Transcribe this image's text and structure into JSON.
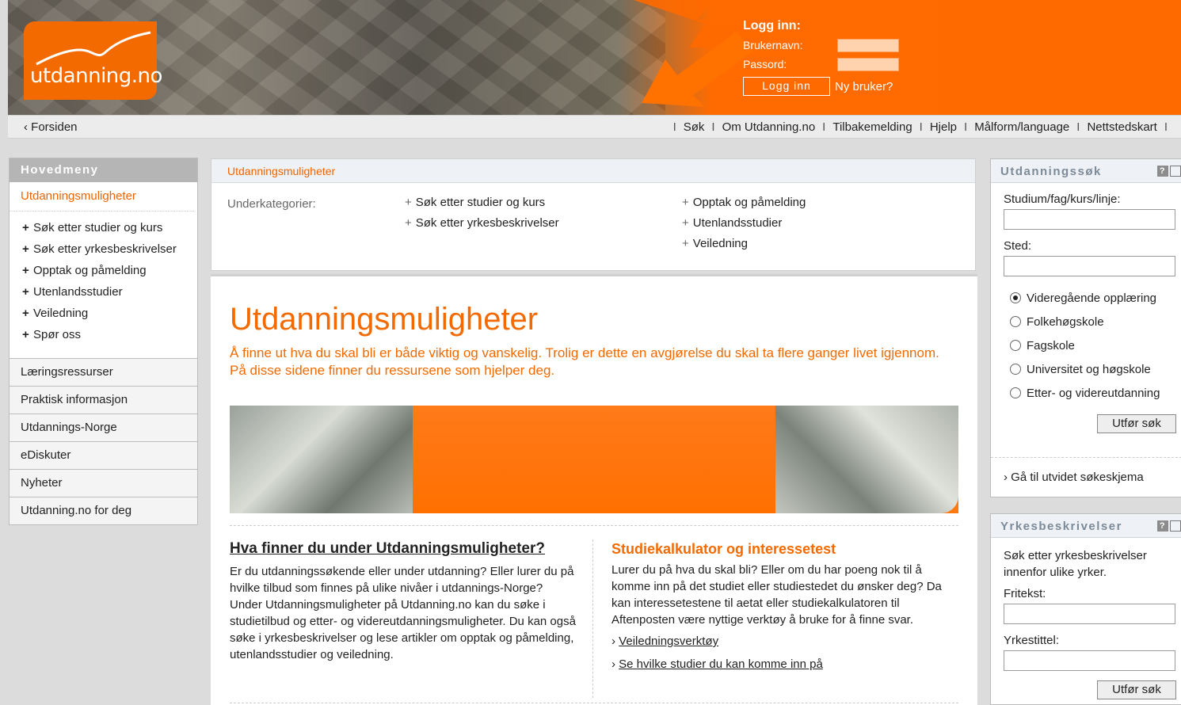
{
  "header": {
    "logo_text": "utdanning.no",
    "login": {
      "title": "Logg inn:",
      "username_label": "Brukernavn:",
      "password_label": "Passord:",
      "button": "Logg inn",
      "new_user": "Ny bruker?"
    }
  },
  "topnav": {
    "home": "‹ Forsiden",
    "links": [
      "Søk",
      "Om Utdanning.no",
      "Tilbakemelding",
      "Hjelp",
      "Målform/language",
      "Nettstedskart"
    ]
  },
  "leftmenu": {
    "title": "Hovedmeny",
    "active": "Utdanningsmuligheter",
    "subitems": [
      "Søk etter studier og kurs",
      "Søk etter yrkesbeskrivelser",
      "Opptak og påmelding",
      "Utenlandsstudier",
      "Veiledning",
      "Spør oss"
    ],
    "items": [
      "Læringsressurser",
      "Praktisk informasjon",
      "Utdannings-Norge",
      "eDiskuter",
      "Nyheter",
      "Utdanning.no for deg"
    ]
  },
  "subcats": {
    "breadcrumb": "Utdanningsmuligheter",
    "label": "Underkategorier:",
    "col1": [
      "Søk etter studier og kurs",
      "Søk etter yrkesbeskrivelser"
    ],
    "col2": [
      "Opptak og påmelding",
      "Utenlandsstudier",
      "Veiledning"
    ]
  },
  "main": {
    "title": "Utdanningsmuligheter",
    "intro": "Å finne ut hva du skal bli er både viktig og vanskelig. Trolig er dette en avgjørelse du skal ta flere ganger livet igjennom. På disse sidene finner du ressursene som hjelper deg.",
    "left": {
      "heading": "Hva finner du under Utdanningsmuligheter?",
      "text": "Er du utdanningssøkende eller under utdanning? Eller lurer du på hvilke tilbud som finnes på ulike nivåer i utdannings-Norge? Under Utdanningsmuligheter på Utdanning.no kan du søke i studietilbud og etter- og videreutdanningsmuligheter. Du kan også søke i yrkesbeskrivelser og lese artikler om opptak og påmelding, utenlandsstudier og veiledning."
    },
    "right": {
      "heading": "Studiekalkulator og interessetest",
      "text": "Lurer du på hva du skal bli? Eller om du har poeng nok til å komme inn på det studiet eller studiestedet du ønsker deg? Da kan interessetestene til aetat eller studiekalkulatoren til Aftenposten være nyttige verktøy å bruke for å finne svar.",
      "link1": "Veiledningsverktøy",
      "link2": "Se hvilke studier du kan komme inn på",
      "link_prefix": "›"
    }
  },
  "search_panel": {
    "title": "Utdanningssøk",
    "help": "?",
    "field1_label": "Studium/fag/kurs/linje:",
    "field2_label": "Sted:",
    "options": [
      "Videregående opplæring",
      "Folkehøgskole",
      "Fagskole",
      "Universitet og høgskole",
      "Etter- og videreutdanning"
    ],
    "selected_index": 0,
    "submit": "Utfør søk",
    "advanced": "› Gå til utvidet søkeskjema"
  },
  "job_panel": {
    "title": "Yrkesbeskrivelser",
    "help": "?",
    "desc": "Søk etter yrkesbeskrivelser innenfor ulike yrker.",
    "field1_label": "Fritekst:",
    "field2_label": "Yrkestittel:",
    "submit": "Utfør søk"
  }
}
